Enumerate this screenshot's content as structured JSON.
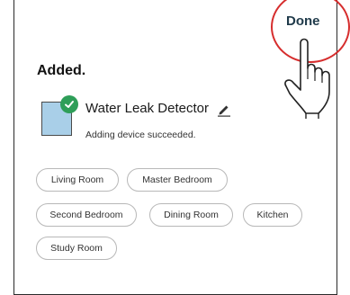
{
  "header": {
    "done_label": "Done"
  },
  "main": {
    "title": "Added.",
    "device": {
      "name": "Water Leak Detector",
      "status": "Adding device succeeded.",
      "icon": "water-leak-detector-icon",
      "icon_color": "#a9cfe8",
      "badge_icon": "check-icon",
      "badge_color": "#2e9e58"
    },
    "rooms": [
      "Living Room",
      "Master Bedroom",
      "Second Bedroom",
      "Dining Room",
      "Kitchen",
      "Study Room"
    ]
  },
  "annotation": {
    "highlight_color": "#d62d2d",
    "pointer_icon": "pointing-hand-icon"
  }
}
